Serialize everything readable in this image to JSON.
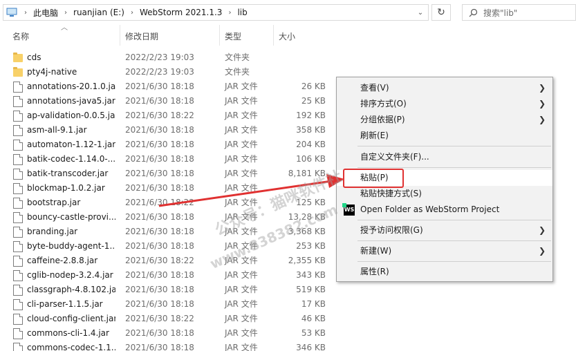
{
  "address_bar": {
    "crumbs": [
      "此电脑",
      "ruanjian (E:)",
      "WebStorm 2021.1.3",
      "lib"
    ]
  },
  "search": {
    "placeholder": "搜索\"lib\""
  },
  "columns": {
    "name": "名称",
    "date": "修改日期",
    "type": "类型",
    "size": "大小"
  },
  "files": [
    {
      "name": "cds",
      "date": "2022/2/23 19:03",
      "type": "文件夹",
      "size": "",
      "kind": "folder"
    },
    {
      "name": "pty4j-native",
      "date": "2022/2/23 19:03",
      "type": "文件夹",
      "size": "",
      "kind": "folder"
    },
    {
      "name": "annotations-20.1.0.jar",
      "date": "2021/6/30 18:18",
      "type": "JAR 文件",
      "size": "26 KB",
      "kind": "file"
    },
    {
      "name": "annotations-java5.jar",
      "date": "2021/6/30 18:18",
      "type": "JAR 文件",
      "size": "25 KB",
      "kind": "file"
    },
    {
      "name": "ap-validation-0.0.5.jar",
      "date": "2021/6/30 18:22",
      "type": "JAR 文件",
      "size": "192 KB",
      "kind": "file"
    },
    {
      "name": "asm-all-9.1.jar",
      "date": "2021/6/30 18:18",
      "type": "JAR 文件",
      "size": "358 KB",
      "kind": "file"
    },
    {
      "name": "automaton-1.12-1.jar",
      "date": "2021/6/30 18:18",
      "type": "JAR 文件",
      "size": "204 KB",
      "kind": "file"
    },
    {
      "name": "batik-codec-1.14.0-...",
      "date": "2021/6/30 18:18",
      "type": "JAR 文件",
      "size": "106 KB",
      "kind": "file"
    },
    {
      "name": "batik-transcoder.jar",
      "date": "2021/6/30 18:18",
      "type": "JAR 文件",
      "size": "8,181 KB",
      "kind": "file"
    },
    {
      "name": "blockmap-1.0.2.jar",
      "date": "2021/6/30 18:18",
      "type": "JAR 文件",
      "size": "",
      "kind": "file"
    },
    {
      "name": "bootstrap.jar",
      "date": "2021/6/30 18:22",
      "type": "JAR 文件",
      "size": "125 KB",
      "kind": "file"
    },
    {
      "name": "bouncy-castle-provi...",
      "date": "2021/6/30 18:18",
      "type": "JAR 文件",
      "size": "13,28 KB",
      "kind": "file"
    },
    {
      "name": "branding.jar",
      "date": "2021/6/30 18:18",
      "type": "JAR 文件",
      "size": "3,368 KB",
      "kind": "file"
    },
    {
      "name": "byte-buddy-agent-1...",
      "date": "2021/6/30 18:18",
      "type": "JAR 文件",
      "size": "253 KB",
      "kind": "file"
    },
    {
      "name": "caffeine-2.8.8.jar",
      "date": "2021/6/30 18:22",
      "type": "JAR 文件",
      "size": "2,355 KB",
      "kind": "file"
    },
    {
      "name": "cglib-nodep-3.2.4.jar",
      "date": "2021/6/30 18:18",
      "type": "JAR 文件",
      "size": "343 KB",
      "kind": "file"
    },
    {
      "name": "classgraph-4.8.102.jar",
      "date": "2021/6/30 18:18",
      "type": "JAR 文件",
      "size": "519 KB",
      "kind": "file"
    },
    {
      "name": "cli-parser-1.1.5.jar",
      "date": "2021/6/30 18:18",
      "type": "JAR 文件",
      "size": "17 KB",
      "kind": "file"
    },
    {
      "name": "cloud-config-client.jar",
      "date": "2021/6/30 18:22",
      "type": "JAR 文件",
      "size": "46 KB",
      "kind": "file"
    },
    {
      "name": "commons-cli-1.4.jar",
      "date": "2021/6/30 18:18",
      "type": "JAR 文件",
      "size": "53 KB",
      "kind": "file"
    },
    {
      "name": "commons-codec-1.1...",
      "date": "2021/6/30 18:18",
      "type": "JAR 文件",
      "size": "346 KB",
      "kind": "file"
    }
  ],
  "context_menu": {
    "view": "查看(V)",
    "sort_by": "排序方式(O)",
    "group_by": "分组依据(P)",
    "refresh": "刷新(E)",
    "customize_folder": "自定义文件夹(F)...",
    "paste": "粘贴(P)",
    "paste_shortcut": "粘贴快捷方式(S)",
    "open_webstorm": "Open Folder as WebStorm Project",
    "grant_access": "授予访问权限(G)",
    "new": "新建(W)",
    "properties": "属性(R)"
  },
  "watermark": {
    "line1": "公众号：猫咪软件社",
    "line2": "www.838382.com"
  },
  "colors": {
    "annotation_red": "#e03131",
    "folder_yellow": "#f8d169",
    "menu_bg": "#f2f2f2"
  }
}
